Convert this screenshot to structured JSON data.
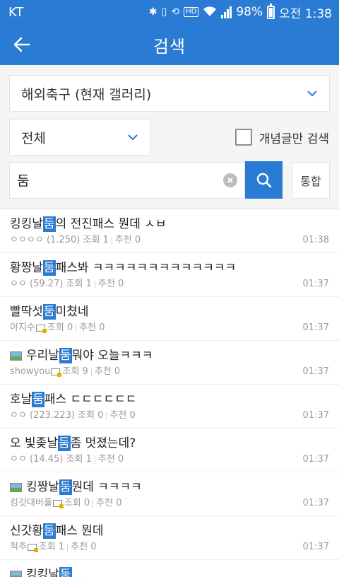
{
  "status_bar": {
    "carrier": "KT",
    "battery": "98%",
    "time": "오전 1:38",
    "hd_label": "HD"
  },
  "app_bar": {
    "title": "검색"
  },
  "search_form": {
    "gallery_select": "해외축구 (현재 갤러리)",
    "scope_select": "전체",
    "concept_only_label": "개념글만 검색",
    "concept_only_checked": false,
    "query": "둠",
    "integrated_button": "통합"
  },
  "results": [
    {
      "pre": "킹킹날",
      "hl": "둠",
      "post": "의 전진패스 뭔데 ㅅㅂ",
      "has_image": false,
      "author": "ㅇㅇㅇㅇ (1.250)",
      "fixed_nick": false,
      "views": "조회 1",
      "recommend": "추천 0",
      "time": "01:38"
    },
    {
      "pre": "황짱날",
      "hl": "둠",
      "post": " 패스봐 ㅋㅋㅋㅋㅋㅋㅋㅋㅋㅋㅋㅋㅋ",
      "has_image": false,
      "author": "ㅇㅇ (59.27)",
      "fixed_nick": false,
      "views": "조회 1",
      "recommend": "추천 0",
      "time": "01:37"
    },
    {
      "pre": "빨딱섯",
      "hl": "둠",
      "post": " 미쳤네",
      "has_image": false,
      "author": "야지수",
      "fixed_nick": true,
      "views": "조회 0",
      "recommend": "추천 0",
      "time": "01:37"
    },
    {
      "pre": "우리날",
      "hl": "둠",
      "post": " 뭐야 오늘ㅋㅋㅋ",
      "has_image": true,
      "author": "showyou",
      "fixed_nick": true,
      "views": "조회 9",
      "recommend": "추천 0",
      "time": "01:37"
    },
    {
      "pre": "호날",
      "hl": "둠",
      "post": " 패스 ㄷㄷㄷㄷㄷㄷ",
      "has_image": false,
      "author": "ㅇㅇ (223.223)",
      "fixed_nick": false,
      "views": "조회 0",
      "recommend": "추천 0",
      "time": "01:37"
    },
    {
      "pre": "오 빛좆날",
      "hl": "둠",
      "post": " 좀 멋졌는데?",
      "has_image": false,
      "author": "ㅇㅇ (14.45)",
      "fixed_nick": false,
      "views": "조회 1",
      "recommend": "추천 0",
      "time": "01:37"
    },
    {
      "pre": "킹짱날",
      "hl": "둠",
      "post": " 뭔데 ㅋㅋㅋㅋ",
      "has_image": true,
      "author": "킹갓대버풀",
      "fixed_nick": true,
      "views": "조회 0",
      "recommend": "추천 0",
      "time": "01:37"
    },
    {
      "pre": "신갓황",
      "hl": "둠",
      "post": " 패스 뭔데",
      "has_image": false,
      "author": "척추",
      "fixed_nick": true,
      "views": "조회 1",
      "recommend": "추천 0",
      "time": "01:37"
    },
    {
      "pre": "킹킹날",
      "hl": "둠",
      "post": "...",
      "has_image": true,
      "author": "",
      "fixed_nick": false,
      "views": "",
      "recommend": "",
      "time": ""
    }
  ],
  "colors": {
    "primary": "#2a7bd3",
    "highlight": "#2a7bd3",
    "meta_text": "#9a9a9a"
  }
}
